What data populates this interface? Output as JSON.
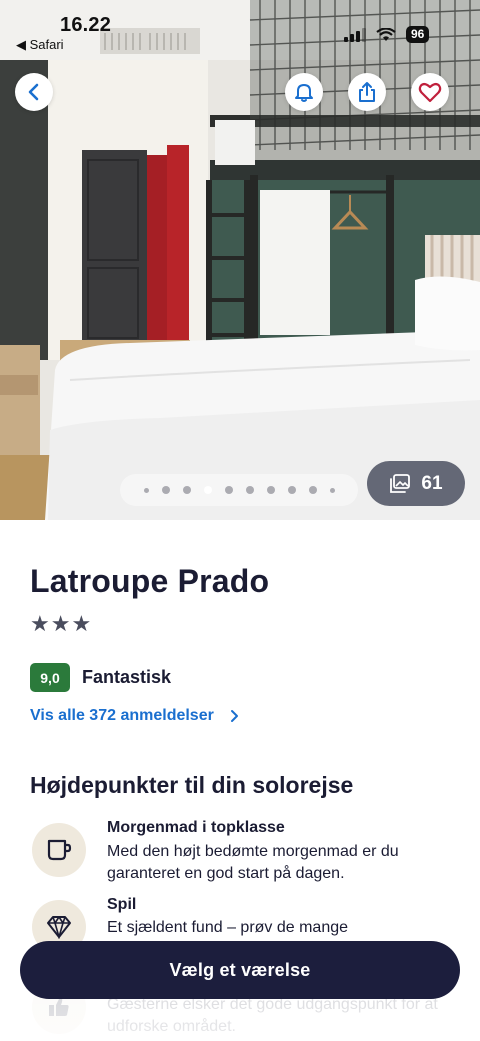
{
  "status_bar": {
    "time": "16.22",
    "back_app": "◀ Safari",
    "battery": "96"
  },
  "gallery": {
    "photo_count": "61",
    "dots_total": 10,
    "dots_active_index": 3
  },
  "hotel": {
    "name": "Latroupe Prado",
    "stars": "★★★",
    "rating_score": "9,0",
    "rating_label": "Fantastisk",
    "reviews_link": "Vis alle 372 anmeldelser"
  },
  "highlights": {
    "title": "Højdepunkter til din solorejse",
    "items": [
      {
        "icon": "mug-icon",
        "title": "Morgenmad i topklasse",
        "description": "Med den højt bedømte morgenmad er du garanteret en god start på dagen."
      },
      {
        "icon": "diamond-icon",
        "title": "Spil",
        "description": "Et sjældent fund – prøv de mange"
      },
      {
        "icon": "thumbs-up-icon",
        "title": "",
        "description": "Gæsterne elsker det gode udgangspunkt for at udforske området."
      }
    ]
  },
  "cta": {
    "label": "Vælg et værelse"
  },
  "colors": {
    "navy": "#1c1e3d",
    "link_blue": "#1a6fcf",
    "rating_green": "#2b7a3b",
    "icon_bg": "#efe9dd",
    "accent_heart": "#c0203c"
  }
}
